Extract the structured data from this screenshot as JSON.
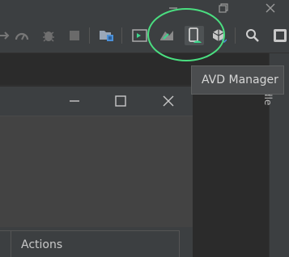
{
  "toolbar": {
    "items": [
      {
        "icon": "debug-arrow-icon"
      },
      {
        "icon": "profiler-icon"
      },
      {
        "icon": "attach-debugger-icon"
      },
      {
        "icon": "stop-icon"
      },
      {
        "icon": "project-structure-icon"
      },
      {
        "icon": "run-console-icon"
      },
      {
        "icon": "sdk-manager-icon"
      },
      {
        "icon": "avd-manager-icon"
      },
      {
        "icon": "sync-gradle-icon"
      },
      {
        "icon": "search-icon"
      },
      {
        "icon": "overflow-icon"
      }
    ]
  },
  "tooltip": {
    "text": "AVD Manager"
  },
  "dialog": {
    "table": {
      "columns": [
        "",
        "Actions"
      ]
    }
  },
  "side_panel": {
    "label": "dle"
  },
  "colors": {
    "background": "#2b2b2b",
    "panel": "#3c3f41",
    "highlight": "#4ade80",
    "accent_green": "#3dd68c",
    "icon_blue": "#4a90d9"
  }
}
